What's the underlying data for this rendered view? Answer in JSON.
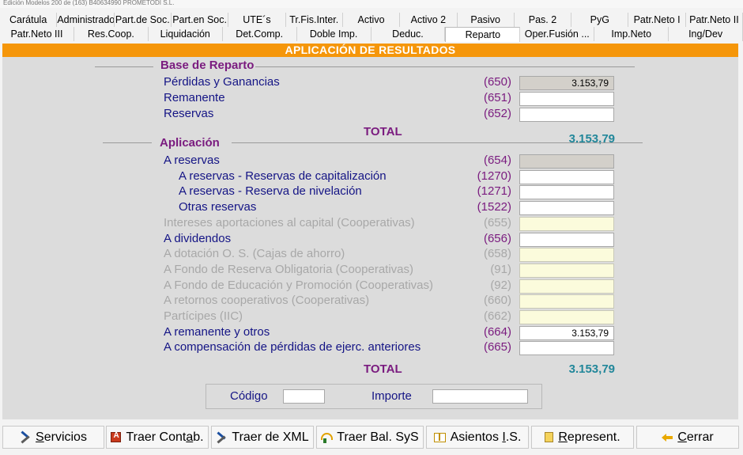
{
  "window": {
    "title": "Edición Modelos 200 de (163) B40634990 PROMETODI S.L."
  },
  "tabs_row1": [
    "Carátula",
    "Administradores",
    "Part.de Soc.",
    "Part.en Soc.",
    "UTE´s",
    "Tr.Fis.Inter.",
    "Activo",
    "Activo 2",
    "Pasivo",
    "Pas. 2",
    "PyG",
    "Patr.Neto I",
    "Patr.Neto II"
  ],
  "tabs_row2": [
    "Patr.Neto III",
    "Res.Coop.",
    "Liquidación",
    "Det.Comp.",
    "Doble Imp.",
    "Deduc.",
    "Reparto",
    "Oper.Fusión ...",
    "Imp.Neto",
    "Ing/Dev"
  ],
  "active_tab": "Reparto",
  "banner": "APLICACIÓN DE RESULTADOS",
  "base": {
    "title": "Base de Reparto",
    "rows": [
      {
        "label": "Pérdidas y Ganancias",
        "code": "(650)",
        "value": "3.153,79",
        "state": "readonly"
      },
      {
        "label": "Remanente",
        "code": "(651)",
        "value": "",
        "state": "editable"
      },
      {
        "label": "Reservas",
        "code": "(652)",
        "value": "",
        "state": "editable"
      }
    ],
    "total_label": "TOTAL",
    "total_value": "3.153,79"
  },
  "aplicacion": {
    "title": "Aplicación",
    "rows": [
      {
        "label": "A reservas",
        "code": "(654)",
        "value": "",
        "state": "readonly",
        "indent": false
      },
      {
        "label": "A reservas - Reservas de capitalización",
        "code": "(1270)",
        "value": "",
        "state": "editable",
        "indent": true
      },
      {
        "label": "A reservas - Reserva de nivelación",
        "code": "(1271)",
        "value": "",
        "state": "editable",
        "indent": true
      },
      {
        "label": "Otras reservas",
        "code": "(1522)",
        "value": "",
        "state": "editable",
        "indent": true
      },
      {
        "label": "Intereses aportaciones al capital (Cooperativas)",
        "code": "(655)",
        "value": "",
        "state": "disabled",
        "indent": false
      },
      {
        "label": "A dividendos",
        "code": "(656)",
        "value": "",
        "state": "editable",
        "indent": false
      },
      {
        "label": "A dotación O. S. (Cajas de ahorro)",
        "code": "(658)",
        "value": "",
        "state": "disabled",
        "indent": false
      },
      {
        "label": "A Fondo de Reserva Obligatoria (Cooperativas)",
        "code": "(91)",
        "value": "",
        "state": "disabled",
        "indent": false
      },
      {
        "label": "A Fondo de Educación y Promoción (Cooperativas)",
        "code": "(92)",
        "value": "",
        "state": "disabled",
        "indent": false
      },
      {
        "label": "A retornos cooperativos (Cooperativas)",
        "code": "(660)",
        "value": "",
        "state": "disabled",
        "indent": false
      },
      {
        "label": "Partícipes (IIC)",
        "code": "(662)",
        "value": "",
        "state": "disabled",
        "indent": false
      },
      {
        "label": "A remanente y otros",
        "code": "(664)",
        "value": "3.153,79",
        "state": "editable",
        "indent": false
      },
      {
        "label": "A compensación de pérdidas de ejerc. anteriores",
        "code": "(665)",
        "value": "",
        "state": "editable",
        "indent": false
      }
    ],
    "total_label": "TOTAL",
    "total_value": "3.153,79"
  },
  "search": {
    "codigo_label": "Código",
    "importe_label": "Importe"
  },
  "buttons": [
    {
      "id": "servicios",
      "label": "Servicios",
      "icon": "tools-icon",
      "key_index": 0
    },
    {
      "id": "traer-contab",
      "label": "Traer Contab.",
      "icon": "pdf-icon",
      "key_index": 10
    },
    {
      "id": "traer-xml",
      "label": "Traer de XML",
      "icon": "tools-icon",
      "key_index": -1
    },
    {
      "id": "traer-bal-sys",
      "label": "Traer Bal. SyS",
      "icon": "balance-icon",
      "key_index": -1
    },
    {
      "id": "asientos-is",
      "label": "Asientos I.S.",
      "icon": "book-icon",
      "key_index": 9
    },
    {
      "id": "represent",
      "label": "Represent.",
      "icon": "report-icon",
      "key_index": 0
    },
    {
      "id": "cerrar",
      "label": "Cerrar",
      "icon": "back-arrow-icon",
      "key_index": 0
    }
  ]
}
